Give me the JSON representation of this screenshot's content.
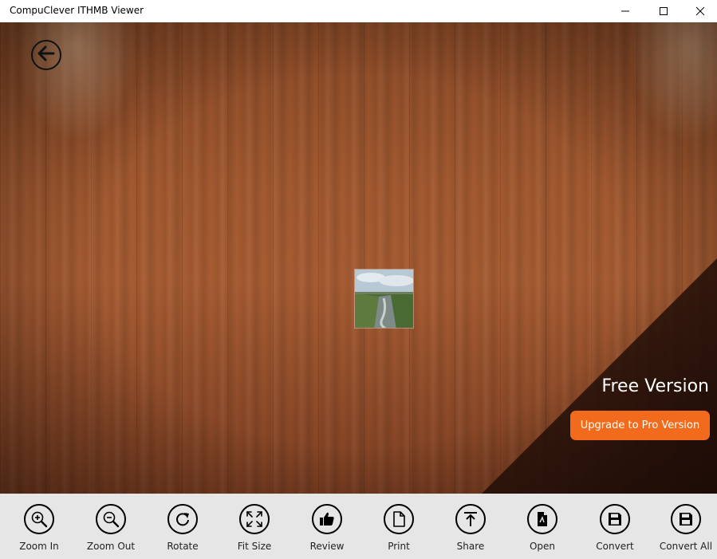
{
  "window": {
    "title": "CompuClever ITHMB Viewer",
    "controls": [
      "minimize-icon",
      "maximize-icon",
      "close-icon"
    ]
  },
  "stage": {
    "back_icon": "arrow-left-icon",
    "free_version_text": "Free Version",
    "upgrade_label": "Upgrade to Pro Version",
    "accent_color": "#f26a1b"
  },
  "toolbar": {
    "items": [
      {
        "label": "Zoom In",
        "icon": "zoom-in-icon"
      },
      {
        "label": "Zoom Out",
        "icon": "zoom-out-icon"
      },
      {
        "label": "Rotate",
        "icon": "rotate-icon"
      },
      {
        "label": "Fit Size",
        "icon": "fit-size-icon"
      },
      {
        "label": "Review",
        "icon": "thumbs-up-icon"
      },
      {
        "label": "Print",
        "icon": "page-icon"
      },
      {
        "label": "Share",
        "icon": "share-icon"
      },
      {
        "label": "Open",
        "icon": "open-file-icon"
      },
      {
        "label": "Convert",
        "icon": "save-icon"
      },
      {
        "label": "Convert All",
        "icon": "save-all-icon"
      }
    ]
  }
}
